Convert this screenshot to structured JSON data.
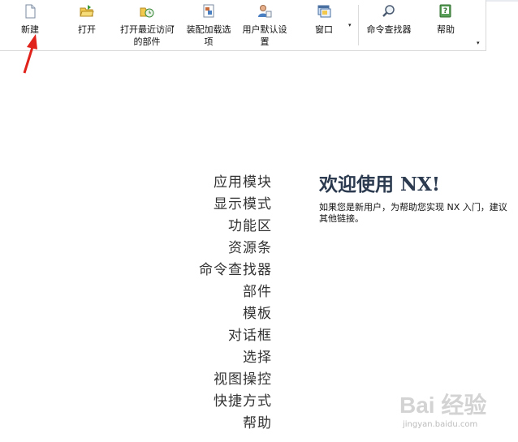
{
  "toolbar": {
    "buttons": [
      {
        "label": "新建",
        "icon": "new-file-icon"
      },
      {
        "label": "打开",
        "icon": "open-folder-icon"
      },
      {
        "label": "打开最近访问\n的部件",
        "icon": "recent-parts-icon"
      },
      {
        "label": "装配加载选\n项",
        "icon": "assembly-load-options-icon"
      },
      {
        "label": "用户默认设\n置",
        "icon": "user-defaults-icon"
      },
      {
        "label": "窗口",
        "icon": "window-icon"
      },
      {
        "label": "命令查找器",
        "icon": "search-icon"
      },
      {
        "label": "帮助",
        "icon": "help-icon"
      }
    ],
    "dropdown_glyph": "▾"
  },
  "nav": {
    "items": [
      "应用模块",
      "显示模式",
      "功能区",
      "资源条",
      "命令查找器",
      "部件",
      "模板",
      "对话框",
      "选择",
      "视图操控",
      "快捷方式",
      "帮助"
    ]
  },
  "welcome": {
    "title": "欢迎使用 NX!",
    "line1": "如果您是新用户，为帮助您实现 NX 入门，建议",
    "line2": "其他链接。"
  },
  "watermark": {
    "text": "Bai 经验",
    "sub": "jingyan.baidu.com"
  },
  "colors": {
    "annotation_arrow": "#e0221b",
    "title": "#2b3a4f"
  }
}
